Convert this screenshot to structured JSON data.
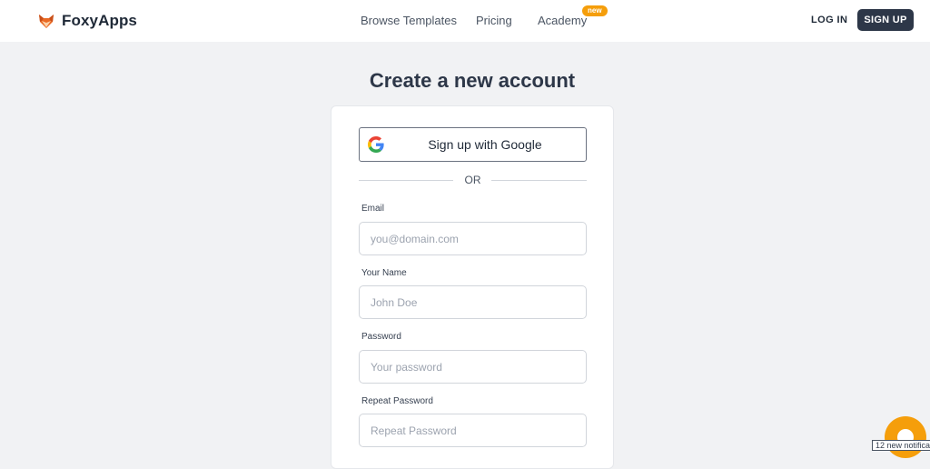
{
  "brand": {
    "name": "FoxyApps",
    "logo_icon": "fox-logo-icon",
    "logo_color": "#ea6a25"
  },
  "nav": {
    "items": [
      {
        "label": "Browse Templates"
      },
      {
        "label": "Pricing"
      },
      {
        "label": "Academy",
        "badge": "new"
      }
    ]
  },
  "auth": {
    "login_label": "LOG IN",
    "signup_label": "SIGN UP"
  },
  "page": {
    "title": "Create a new account"
  },
  "form": {
    "google_button_label": "Sign up with Google",
    "google_icon": "google-icon",
    "divider_text": "OR",
    "fields": [
      {
        "label": "Email",
        "placeholder": "you@domain.com",
        "value": ""
      },
      {
        "label": "Your Name",
        "placeholder": "John Doe",
        "value": ""
      },
      {
        "label": "Password",
        "placeholder": "Your password",
        "value": ""
      },
      {
        "label": "Repeat Password",
        "placeholder": "Repeat Password",
        "value": ""
      }
    ]
  },
  "widget": {
    "chat_icon": "chat-bubble-icon",
    "chat_color": "#f59e0b",
    "notification_text": "12 new notifica"
  },
  "colors": {
    "accent": "#2d3748",
    "badge": "#f59e0b",
    "background": "#f1f2f4"
  }
}
